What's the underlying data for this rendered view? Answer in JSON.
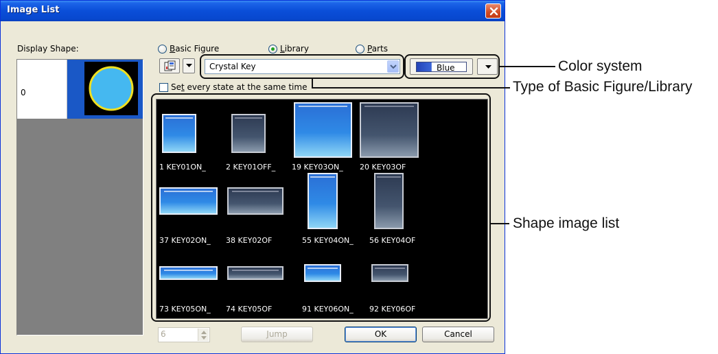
{
  "window": {
    "title": "Image List"
  },
  "display_shape": {
    "label": "Display Shape:",
    "rows": [
      {
        "number": "0"
      }
    ]
  },
  "source": {
    "options": [
      {
        "prefix": "",
        "mnemonic": "B",
        "rest": "asic Figure",
        "selected": false
      },
      {
        "prefix": "",
        "mnemonic": "L",
        "rest": "ibrary",
        "selected": true
      },
      {
        "prefix": "",
        "mnemonic": "P",
        "rest": "arts",
        "selected": false
      }
    ]
  },
  "library_combo": {
    "value": "Crystal Key"
  },
  "color": {
    "value": "Blue",
    "accent": "#2f55cc"
  },
  "checkbox": {
    "checked": false,
    "prefix": "Se",
    "mnemonic": "t",
    "rest": " every state at the same time"
  },
  "image_list": {
    "items": [
      {
        "label": "1 KEY01ON_",
        "state": "on"
      },
      {
        "label": "2 KEY01OFF_",
        "state": "off"
      },
      {
        "label": "19 KEY03ON_",
        "state": "on"
      },
      {
        "label": "20 KEY03OF",
        "state": "off"
      },
      {
        "label": "37 KEY02ON_",
        "state": "on"
      },
      {
        "label": "38 KEY02OF",
        "state": "off"
      },
      {
        "label": "55 KEY04ON_",
        "state": "on"
      },
      {
        "label": "56 KEY04OF",
        "state": "off"
      },
      {
        "label": "73 KEY05ON_",
        "state": "on"
      },
      {
        "label": "74 KEY05OF",
        "state": "off"
      },
      {
        "label": "91 KEY06ON_",
        "state": "on"
      },
      {
        "label": "92 KEY06OF",
        "state": "off"
      }
    ]
  },
  "footer": {
    "spin_value": "6",
    "jump": {
      "mnemonic": "J",
      "rest": "ump"
    },
    "ok": "OK",
    "cancel": "Cancel"
  },
  "callouts": {
    "color_system": "Color system",
    "type": "Type of Basic Figure/Library",
    "shape_list": "Shape image list"
  }
}
